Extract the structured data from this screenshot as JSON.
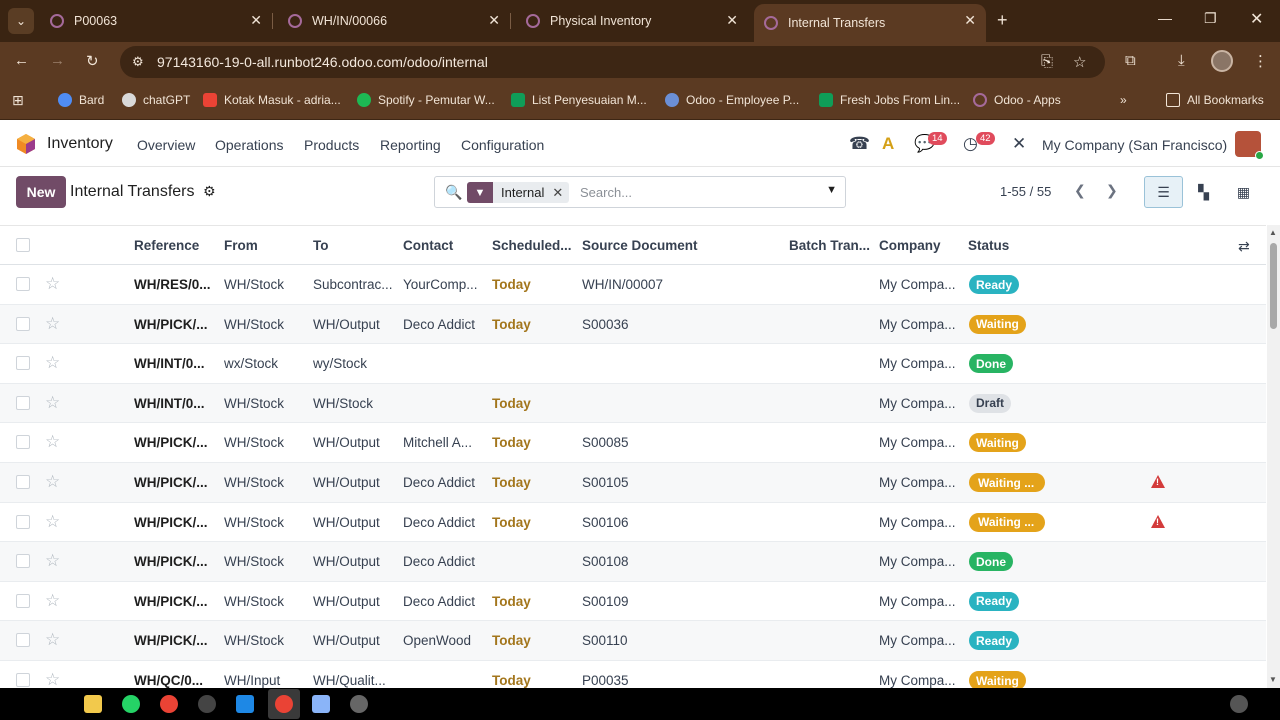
{
  "browser": {
    "tabs": [
      {
        "title": "P00063",
        "active": false
      },
      {
        "title": "WH/IN/00066",
        "active": false
      },
      {
        "title": "Physical Inventory",
        "active": false
      },
      {
        "title": "Internal Transfers",
        "active": true
      }
    ],
    "url": "97143160-19-0-all.runbot246.odoo.com/odoo/internal",
    "bookmarks": [
      {
        "label": "Bard",
        "color": "#4f8df5"
      },
      {
        "label": "chatGPT",
        "color": "#d9d9d9"
      },
      {
        "label": "Kotak Masuk - adria...",
        "color": "#ea4335"
      },
      {
        "label": "Spotify - Pemutar W...",
        "color": "#1db954"
      },
      {
        "label": "List Penyesuaian M...",
        "color": "#0f9d58"
      },
      {
        "label": "Odoo - Employee P...",
        "color": "#6b8fd6"
      },
      {
        "label": "Fresh Jobs From Lin...",
        "color": "#0f9d58"
      },
      {
        "label": "Odoo - Apps",
        "color": "#a56a9a"
      }
    ],
    "all_bookmarks": "All Bookmarks",
    "more_bookmarks": "»"
  },
  "odoo": {
    "app_name": "Inventory",
    "menu": [
      "Overview",
      "Operations",
      "Products",
      "Reporting",
      "Configuration"
    ],
    "chat_count": "14",
    "activity_count": "42",
    "company": "My Company (San Francisco)"
  },
  "control": {
    "new_label": "New",
    "title": "Internal Transfers",
    "facet_label": "Internal",
    "search_placeholder": "Search...",
    "pager": "1-55 / 55"
  },
  "table": {
    "columns": [
      "Reference",
      "From",
      "To",
      "Contact",
      "Scheduled...",
      "Source Document",
      "Batch Tran...",
      "Company",
      "Status"
    ],
    "rows": [
      {
        "reference": "WH/RES/0...",
        "from": "WH/Stock",
        "to": "Subcontrac...",
        "contact": "YourComp...",
        "scheduled": "Today",
        "source": "WH/IN/00007",
        "batch": "",
        "company": "My Compa...",
        "status": "Ready",
        "warn": false
      },
      {
        "reference": "WH/PICK/...",
        "from": "WH/Stock",
        "to": "WH/Output",
        "contact": "Deco Addict",
        "scheduled": "Today",
        "source": "S00036",
        "batch": "",
        "company": "My Compa...",
        "status": "Waiting",
        "warn": false
      },
      {
        "reference": "WH/INT/0...",
        "from": "wx/Stock",
        "to": "wy/Stock",
        "contact": "",
        "scheduled": "",
        "source": "",
        "batch": "",
        "company": "My Compa...",
        "status": "Done",
        "warn": false
      },
      {
        "reference": "WH/INT/0...",
        "from": "WH/Stock",
        "to": "WH/Stock",
        "contact": "",
        "scheduled": "Today",
        "source": "",
        "batch": "",
        "company": "My Compa...",
        "status": "Draft",
        "warn": false
      },
      {
        "reference": "WH/PICK/...",
        "from": "WH/Stock",
        "to": "WH/Output",
        "contact": "Mitchell A...",
        "scheduled": "Today",
        "source": "S00085",
        "batch": "",
        "company": "My Compa...",
        "status": "Waiting",
        "warn": false
      },
      {
        "reference": "WH/PICK/...",
        "from": "WH/Stock",
        "to": "WH/Output",
        "contact": "Deco Addict",
        "scheduled": "Today",
        "source": "S00105",
        "batch": "",
        "company": "My Compa...",
        "status": "Waiting ...",
        "warn": true
      },
      {
        "reference": "WH/PICK/...",
        "from": "WH/Stock",
        "to": "WH/Output",
        "contact": "Deco Addict",
        "scheduled": "Today",
        "source": "S00106",
        "batch": "",
        "company": "My Compa...",
        "status": "Waiting ...",
        "warn": true
      },
      {
        "reference": "WH/PICK/...",
        "from": "WH/Stock",
        "to": "WH/Output",
        "contact": "Deco Addict",
        "scheduled": "",
        "source": "S00108",
        "batch": "",
        "company": "My Compa...",
        "status": "Done",
        "warn": false
      },
      {
        "reference": "WH/PICK/...",
        "from": "WH/Stock",
        "to": "WH/Output",
        "contact": "Deco Addict",
        "scheduled": "Today",
        "source": "S00109",
        "batch": "",
        "company": "My Compa...",
        "status": "Ready",
        "warn": false
      },
      {
        "reference": "WH/PICK/...",
        "from": "WH/Stock",
        "to": "WH/Output",
        "contact": "OpenWood",
        "scheduled": "Today",
        "source": "S00110",
        "batch": "",
        "company": "My Compa...",
        "status": "Ready",
        "warn": false
      },
      {
        "reference": "WH/QC/0...",
        "from": "WH/Input",
        "to": "WH/Qualit...",
        "contact": "",
        "scheduled": "Today",
        "source": "P00035",
        "batch": "",
        "company": "My Compa...",
        "status": "Waiting",
        "warn": false
      }
    ]
  },
  "status_colors": {
    "Ready": {
      "bg": "#2ab3c1",
      "fg": "#ffffff"
    },
    "Waiting": {
      "bg": "#e4a31a",
      "fg": "#ffffff"
    },
    "Waiting ...": {
      "bg": "#e4a31a",
      "fg": "#ffffff"
    },
    "Done": {
      "bg": "#28b463",
      "fg": "#ffffff"
    },
    "Draft": {
      "bg": "#dfe2e6",
      "fg": "#374151"
    }
  }
}
